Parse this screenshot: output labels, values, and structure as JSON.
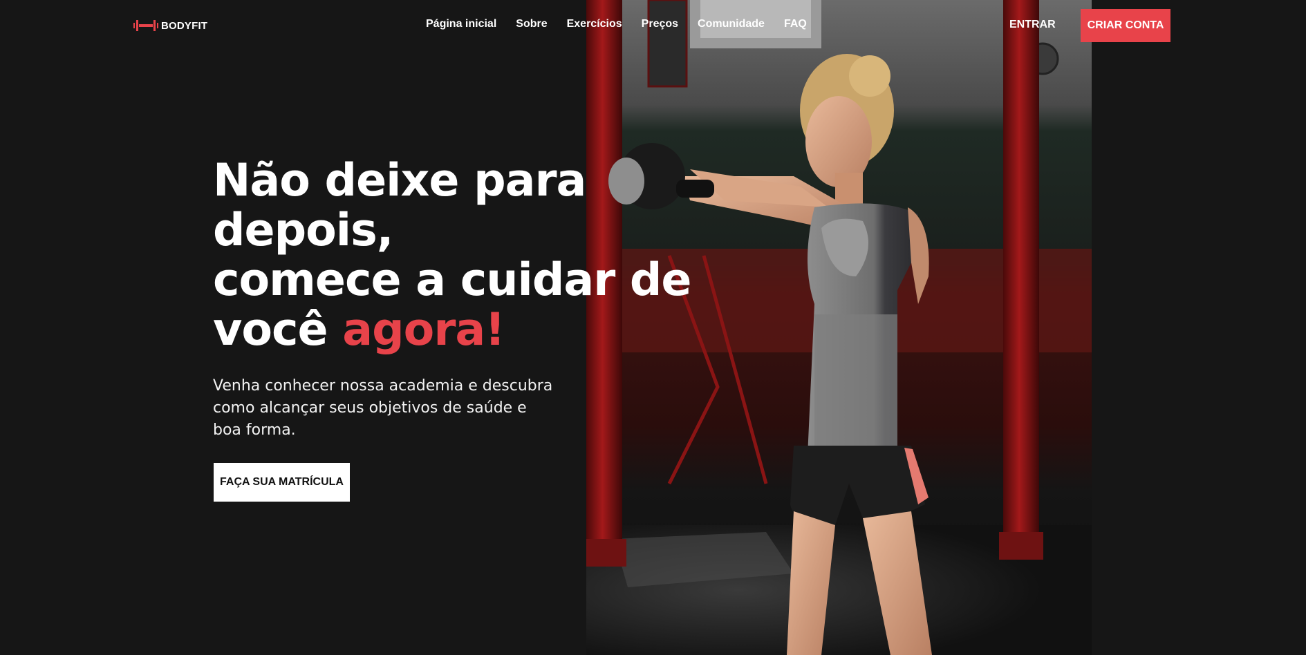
{
  "brand": {
    "name": "BODYFIT",
    "icon": "dumbbell-icon",
    "accent_color": "#e8434a"
  },
  "nav": {
    "items": [
      {
        "label": "Página inicial"
      },
      {
        "label": "Sobre"
      },
      {
        "label": "Exercícios"
      },
      {
        "label": "Preços"
      },
      {
        "label": "Comunidade"
      },
      {
        "label": "FAQ"
      }
    ]
  },
  "header_actions": {
    "login_label": "ENTRAR",
    "signup_label": "CRIAR CONTA"
  },
  "hero": {
    "title_line_1": "Não deixe para",
    "title_line_2": "depois,",
    "title_line_3": "comece a cuidar de",
    "title_line_4_prefix": "você ",
    "title_line_4_accent": "agora!",
    "subtitle_line_1": "Venha conhecer nossa academia e descubra",
    "subtitle_line_2": "como alcançar seus objetivos de saúde e",
    "subtitle_line_3": "boa forma.",
    "cta_label": "FAÇA SUA MATRÍCULA",
    "image": "woman-training-kettlebell-photo"
  },
  "colors": {
    "background": "#161616",
    "text": "#ffffff",
    "accent": "#e8434a",
    "cta_background": "#ffffff"
  }
}
